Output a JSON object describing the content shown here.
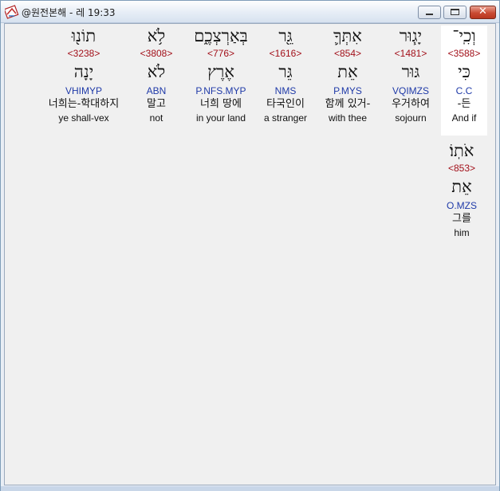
{
  "window": {
    "title": "@원전본해 - 레 19:33",
    "minimize_glyph": "minimize-icon",
    "maximize_glyph": "maximize-icon",
    "close_label": "✕"
  },
  "words": [
    {
      "hebrew": "וְכִֽי־",
      "strong": "<3588>",
      "lemma": "כִּי",
      "morph": "C.C",
      "korean": "-든",
      "english": "And if",
      "highlight": true
    },
    {
      "hebrew": "יָג֧וּר",
      "strong": "<1481>",
      "lemma": "גּוּר",
      "morph": "VQIMZS",
      "korean": "우거하여",
      "english": "sojourn"
    },
    {
      "hebrew": "אִתְּךָ֛",
      "strong": "<854>",
      "lemma": "אֵת",
      "morph": "P.MYS",
      "korean": "함께 있거-",
      "english": "with thee"
    },
    {
      "hebrew": "גֵּ֖ר",
      "strong": "<1616>",
      "lemma": "גֵּר",
      "morph": "NMS",
      "korean": "타국인이",
      "english": "a stranger"
    },
    {
      "hebrew": "בְּאַרְצְכֶ֑ם",
      "strong": "<776>",
      "lemma": "אֶרֶץ",
      "morph": "P.NFS.MYP",
      "korean": "너희 땅에",
      "english": "in your land"
    },
    {
      "hebrew": "לֹ֥א",
      "strong": "<3808>",
      "lemma": "לֹא",
      "morph": "ABN",
      "korean": "말고",
      "english": "not"
    },
    {
      "hebrew": "תוֹנ֖וּ",
      "strong": "<3238>",
      "lemma": "יָנָה",
      "morph": "VHIMYP",
      "korean": "너희는-학대하지",
      "english": "ye shall-vex"
    },
    {
      "hebrew": "אֹתֽוֹ׃",
      "strong": "<853>",
      "lemma": "אֵת",
      "morph": "O.MZS",
      "korean": "그를",
      "english": "him"
    }
  ]
}
